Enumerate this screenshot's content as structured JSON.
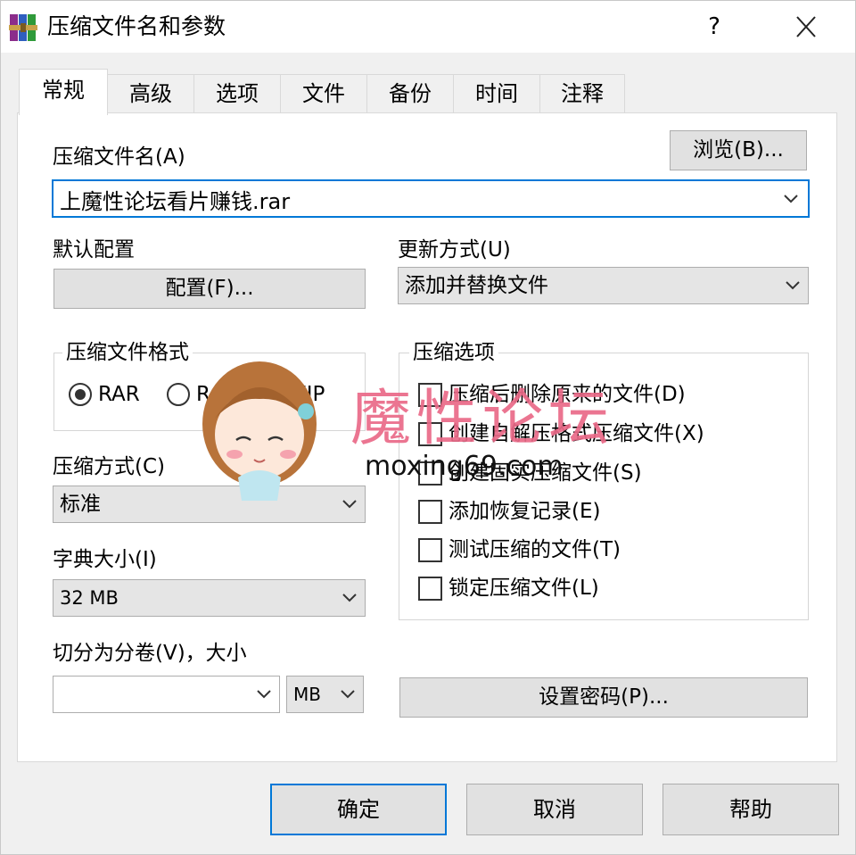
{
  "window": {
    "title": "压缩文件名和参数",
    "help_glyph": "?",
    "close_icon": "close-icon"
  },
  "tabs": [
    {
      "label": "常规",
      "active": true
    },
    {
      "label": "高级"
    },
    {
      "label": "选项"
    },
    {
      "label": "文件"
    },
    {
      "label": "备份"
    },
    {
      "label": "时间"
    },
    {
      "label": "注释"
    }
  ],
  "archive": {
    "name_label": "压缩文件名(A)",
    "browse_label": "浏览(B)...",
    "name_value": "上魔性论坛看片赚钱.rar"
  },
  "profile": {
    "label": "默认配置",
    "button_label": "配置(F)..."
  },
  "update": {
    "label": "更新方式(U)",
    "value": "添加并替换文件"
  },
  "format": {
    "group_label": "压缩文件格式",
    "options": [
      {
        "label": "RAR",
        "selected": true
      },
      {
        "label": "RAR5",
        "selected": false
      },
      {
        "label": "ZIP",
        "selected": false
      }
    ]
  },
  "method": {
    "label": "压缩方式(C)",
    "value": "标准"
  },
  "dictionary": {
    "label": "字典大小(I)",
    "value": "32 MB"
  },
  "volume": {
    "label": "切分为分卷(V)，大小",
    "size_value": "",
    "unit_value": "MB"
  },
  "options": {
    "group_label": "压缩选项",
    "items": [
      {
        "label": "压缩后删除原来的文件(D)",
        "checked": false
      },
      {
        "label": "创建自解压格式压缩文件(X)",
        "checked": false
      },
      {
        "label": "创建固实压缩文件(S)",
        "checked": false
      },
      {
        "label": "添加恢复记录(E)",
        "checked": false
      },
      {
        "label": "测试压缩的文件(T)",
        "checked": false
      },
      {
        "label": "锁定压缩文件(L)",
        "checked": false
      }
    ]
  },
  "password_button_label": "设置密码(P)...",
  "buttons": {
    "ok": "确定",
    "cancel": "取消",
    "help": "帮助"
  },
  "watermark": {
    "text": "魔性论坛",
    "url": "moxing69.com"
  },
  "colors": {
    "accent": "#0078d7",
    "watermark": "#ea6a88"
  }
}
